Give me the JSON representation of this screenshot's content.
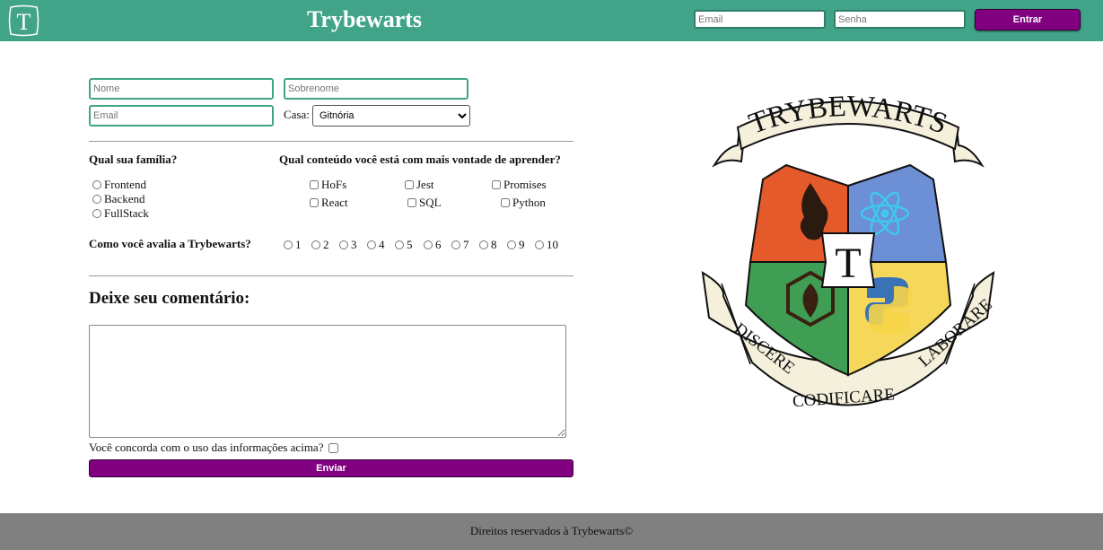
{
  "header": {
    "logo_letter": "T",
    "title": "Trybewarts",
    "email_placeholder": "Email",
    "password_placeholder": "Senha",
    "login_label": "Entrar"
  },
  "form": {
    "name_placeholder": "Nome",
    "lastname_placeholder": "Sobrenome",
    "email_placeholder": "Email",
    "house_label": "Casa:",
    "house_selected": "Gitnória",
    "family_question": "Qual sua família?",
    "families": [
      "Frontend",
      "Backend",
      "FullStack"
    ],
    "content_question": "Qual conteúdo você está com mais vontade de aprender?",
    "subjects": [
      "HoFs",
      "Jest",
      "Promises",
      "React",
      "SQL",
      "Python"
    ],
    "rating_question": "Como você avalia a Trybewarts?",
    "ratings": [
      "1",
      "2",
      "3",
      "4",
      "5",
      "6",
      "7",
      "8",
      "9",
      "10"
    ],
    "comment_heading": "Deixe seu comentário:",
    "agreement_label": "Você concorda com o uso das informações acima?",
    "submit_label": "Enviar"
  },
  "crest": {
    "banner_text": "TRYBEWARTS",
    "center_letter": "T",
    "motto_left": "DISCERE",
    "motto_center": "CODIFICARE",
    "motto_right": "LABORARE",
    "colors": {
      "red": "#e55a2b",
      "blue": "#6c8fd6",
      "green": "#3f9e54",
      "yellow": "#f5d85a",
      "parchment": "#f4f0dc"
    }
  },
  "footer": {
    "text": "Direitos reservados à Trybewarts©"
  },
  "colors": {
    "header": "#41a489",
    "button": "#800080",
    "footer": "#808080"
  }
}
